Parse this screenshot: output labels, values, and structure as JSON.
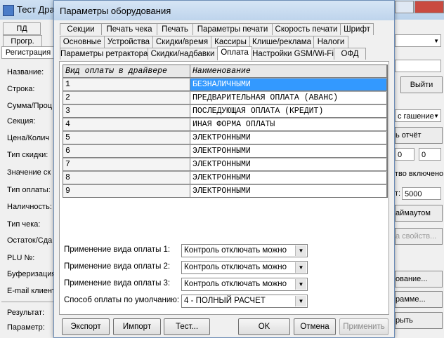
{
  "bg": {
    "title": "Тест Драй",
    "tabs": [
      "ПД",
      "Прогр.",
      "Регистрация"
    ],
    "labels": [
      "Название:",
      "Строка:",
      "Сумма/Проц",
      "Секция:",
      "Цена/Колич",
      "Тип скидки:",
      "Значение ск",
      "Тип оплаты:",
      "Наличность:",
      "Тип чека:",
      "Остаток/Сда",
      "PLU №:",
      "Буферизация",
      "E-mail клиент"
    ],
    "result_label": "Результат:",
    "param_label": "Параметр:",
    "right": {
      "exit_button": "Выйти",
      "gasheniye": "с гашение",
      "report": "ь отчёт",
      "val1": "0",
      "val2": "0",
      "enabled_text": "тво включено",
      "timeout_prefix": "т:",
      "timeout_value": "5000",
      "timeout_button": "аймаутом",
      "props_button": "а свойств...",
      "btn_a": "ование...",
      "btn_b": "рамме...",
      "btn_c": "рыть"
    }
  },
  "dialog": {
    "title": "Параметры оборудования",
    "tab_rows": [
      [
        "Секции",
        "Печать чека",
        "Печать",
        "Параметры печати",
        "Скорость печати",
        "Шрифт"
      ],
      [
        "Основные",
        "Устройства",
        "Скидки/время",
        "Кассиры",
        "Клише/реклама",
        "Налоги"
      ],
      [
        "Параметры ретрактора",
        "Скидки/надбавки",
        "Оплата",
        "Настройки GSM/Wi-Fi",
        "ОФД"
      ]
    ],
    "active_tab": "Оплата",
    "grid": {
      "headers": [
        "Вид оплаты в драйвере",
        "Наименование"
      ],
      "rows": [
        [
          "1",
          "БЕЗНАЛИЧНЫМИ"
        ],
        [
          "2",
          "ПРЕДВАРИТЕЛЬНАЯ ОПЛАТА (АВАНС)"
        ],
        [
          "3",
          "ПОСЛЕДУЮЩАЯ ОПЛАТА (КРЕДИТ)"
        ],
        [
          "4",
          "ИНАЯ ФОРМА ОПЛАТЫ"
        ],
        [
          "5",
          "ЭЛЕКТРОННЫМИ"
        ],
        [
          "6",
          "ЭЛЕКТРОННЫМИ"
        ],
        [
          "7",
          "ЭЛЕКТРОННЫМИ"
        ],
        [
          "8",
          "ЭЛЕКТРОННЫМИ"
        ],
        [
          "9",
          "ЭЛЕКТРОННЫМИ"
        ]
      ],
      "selected_row": 0
    },
    "fields": [
      {
        "label": "Применение вида оплаты 1:",
        "value": "Контроль отключать можно"
      },
      {
        "label": "Применение вида оплаты 2:",
        "value": "Контроль отключать можно"
      },
      {
        "label": "Применение вида оплаты 3:",
        "value": "Контроль отключать можно"
      },
      {
        "label": "Способ оплаты по умолчанию:",
        "value": "4 - ПОЛНЫЙ РАСЧЕТ"
      }
    ],
    "buttons": {
      "export": "Экспорт",
      "import": "Импорт",
      "test": "Тест...",
      "ok": "OK",
      "cancel": "Отмена",
      "apply": "Применить"
    }
  },
  "colors": {
    "selection": "#3399ff",
    "titlebar": "#bed4ec"
  }
}
